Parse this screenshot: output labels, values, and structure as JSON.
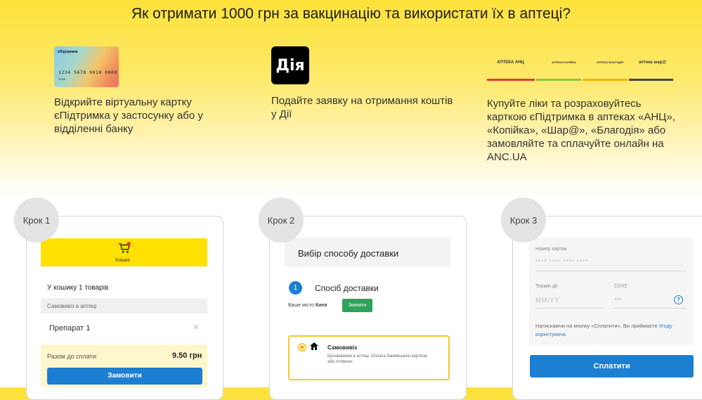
{
  "header": {
    "title": "Як отримати 1000 грн за вакцинацію та використати їх в аптеці?"
  },
  "steps_info": [
    {
      "text": "Відкрийте віртуальну картку єПідтримка у застосунку або у відділенні банку"
    },
    {
      "text": "Подайте заявку на отримання коштів у Дії"
    },
    {
      "text": "Купуйте ліки та розраховуйтесь карткою єПідтримка в аптеках «АНЦ», «Копійка», «Шар@», «Благодія» або замовляйте та сплачуйте онлайн на ANC.UA"
    }
  ],
  "card_image": {
    "brand": "єПідтримка",
    "number": "1234 5678 9010 0000",
    "exp": "12/28"
  },
  "diia_logo": {
    "text": "Дія"
  },
  "pharmacy_logos": [
    {
      "name": "АПТЕКА АНЦ",
      "color": "#e63b2e"
    },
    {
      "name": "АПТЕКА КОПІЙКА",
      "color": "#8dc63f"
    },
    {
      "name": "АПТЕКА БЛАГОДІЯ",
      "color": "#f7b500"
    },
    {
      "name": "аптека шар@",
      "color": "#333333"
    }
  ],
  "step_labels": [
    "Крок 1",
    "Крок 2",
    "Крок 3"
  ],
  "step1": {
    "cart_label": "Кошик",
    "cart_badge": "1",
    "count_text": "У кошику 1 товарів",
    "pickup_label": "Самовивіз в аптеці",
    "product": "Препарат 1",
    "total_label": "Разом до сплати:",
    "total_value": "9.50 грн",
    "order_button": "Замовити"
  },
  "step2": {
    "title": "Вибір способу доставки",
    "step_num": "1",
    "section_title": "Спосіб доставки",
    "city_label": "Ваше місто",
    "city": "Киев",
    "change_button": "Змінити",
    "option_title": "Самовивіз",
    "option_desc": "Бронювання в аптеці. Оплата банківською карткою або готівкою."
  },
  "step3": {
    "card_number_label": "Номер картки",
    "card_number_placeholder": "**** **** **** ****",
    "expiry_label": "Термін дії",
    "expiry_placeholder": "MM/YY",
    "cvv_label": "CVV2",
    "cvv_placeholder": "***",
    "agree_text": "Натискаючи на кнопку «Сплатити», Ви приймаєте",
    "agree_link": "Угоду користувача",
    "pay_button": "Сплатити"
  }
}
